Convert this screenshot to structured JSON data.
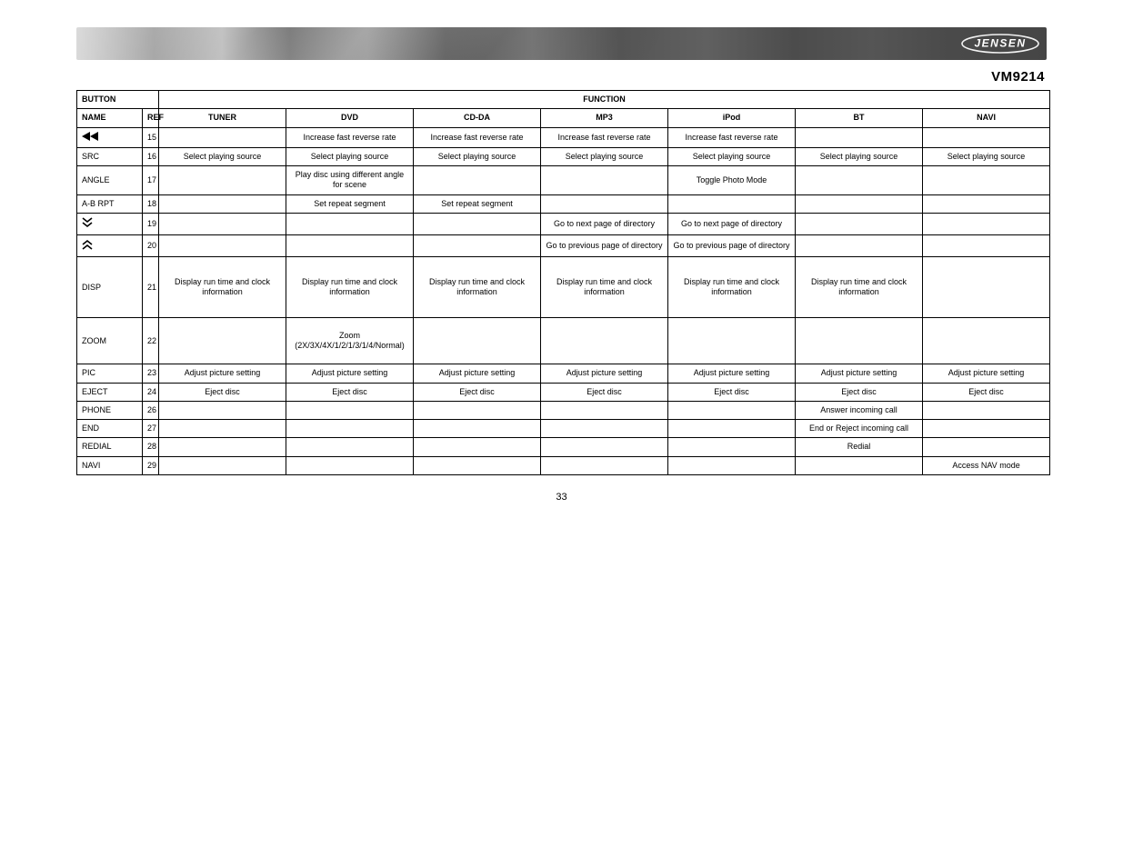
{
  "brand": "JENSEN",
  "model": "VM9214",
  "page_number": "33",
  "table": {
    "top_headers": {
      "button": "BUTTON",
      "function": "FUNCTION"
    },
    "sub_headers": {
      "name": "NAME",
      "ref": "REF",
      "tuner": "TUNER",
      "dvd": "DVD",
      "cdda": "CD-DA",
      "mp3": "MP3",
      "ipod": "iPod",
      "bt": "BT",
      "navi": "NAVI"
    },
    "rows": [
      {
        "name_icon": "rewind",
        "name_text": "",
        "ref": "15",
        "tuner": "",
        "dvd": "Increase fast reverse rate",
        "cdda": "Increase fast reverse rate",
        "mp3": "Increase fast reverse rate",
        "ipod": "Increase fast reverse rate",
        "bt": "",
        "navi": ""
      },
      {
        "name_icon": "",
        "name_text": "SRC",
        "ref": "16",
        "tuner": "Select playing source",
        "dvd": "Select playing source",
        "cdda": "Select playing source",
        "mp3": "Select playing source",
        "ipod": "Select playing source",
        "bt": "Select playing source",
        "navi": "Select playing source"
      },
      {
        "name_icon": "",
        "name_text": "ANGLE",
        "ref": "17",
        "tuner": "",
        "dvd": "Play disc using different angle for scene",
        "cdda": "",
        "mp3": "",
        "ipod": "Toggle Photo Mode",
        "bt": "",
        "navi": ""
      },
      {
        "name_icon": "",
        "name_text": "A-B RPT",
        "ref": "18",
        "tuner": "",
        "dvd": "Set repeat segment",
        "cdda": "Set repeat segment",
        "mp3": "",
        "ipod": "",
        "bt": "",
        "navi": ""
      },
      {
        "name_icon": "page-down",
        "name_text": "",
        "ref": "19",
        "tuner": "",
        "dvd": "",
        "cdda": "",
        "mp3": "Go to next page of directory",
        "ipod": "Go to next page of directory",
        "bt": "",
        "navi": ""
      },
      {
        "name_icon": "page-up",
        "name_text": "",
        "ref": "20",
        "tuner": "",
        "dvd": "",
        "cdda": "",
        "mp3": "Go to previous page of directory",
        "ipod": "Go to previous page of directory",
        "bt": "",
        "navi": ""
      },
      {
        "name_icon": "",
        "name_text": "DISP",
        "ref": "21",
        "tuner": "Display run time and clock information",
        "dvd": "Display run time and clock information",
        "cdda": "Display run time and clock information",
        "mp3": "Display run time and clock information",
        "ipod": "Display run time and clock information",
        "bt": "Display run time and clock information",
        "navi": "",
        "row_class": "tall"
      },
      {
        "name_icon": "",
        "name_text": "ZOOM",
        "ref": "22",
        "tuner": "",
        "dvd": "Zoom (2X/3X/4X/1/2/1/3/1/4/Normal)",
        "cdda": "",
        "mp3": "",
        "ipod": "",
        "bt": "",
        "navi": "",
        "row_class": "mid"
      },
      {
        "name_icon": "",
        "name_text": "PIC",
        "ref": "23",
        "tuner": "Adjust picture setting",
        "dvd": "Adjust picture setting",
        "cdda": "Adjust picture setting",
        "mp3": "Adjust picture setting",
        "ipod": "Adjust picture setting",
        "bt": "Adjust picture setting",
        "navi": "Adjust picture setting"
      },
      {
        "name_icon": "",
        "name_text": "EJECT",
        "ref": "24",
        "tuner": "Eject disc",
        "dvd": "Eject disc",
        "cdda": "Eject disc",
        "mp3": "Eject disc",
        "ipod": "Eject disc",
        "bt": "Eject disc",
        "navi": "Eject disc"
      },
      {
        "name_icon": "",
        "name_text": "PHONE",
        "ref": "26",
        "tuner": "",
        "dvd": "",
        "cdda": "",
        "mp3": "",
        "ipod": "",
        "bt": "Answer incoming call",
        "navi": ""
      },
      {
        "name_icon": "",
        "name_text": "END",
        "ref": "27",
        "tuner": "",
        "dvd": "",
        "cdda": "",
        "mp3": "",
        "ipod": "",
        "bt": "End or Reject incoming call",
        "navi": ""
      },
      {
        "name_icon": "",
        "name_text": "REDIAL",
        "ref": "28",
        "tuner": "",
        "dvd": "",
        "cdda": "",
        "mp3": "",
        "ipod": "",
        "bt": "Redial",
        "navi": ""
      },
      {
        "name_icon": "",
        "name_text": "NAVI",
        "ref": "29",
        "tuner": "",
        "dvd": "",
        "cdda": "",
        "mp3": "",
        "ipod": "",
        "bt": "",
        "navi": "Access NAV mode"
      }
    ]
  }
}
